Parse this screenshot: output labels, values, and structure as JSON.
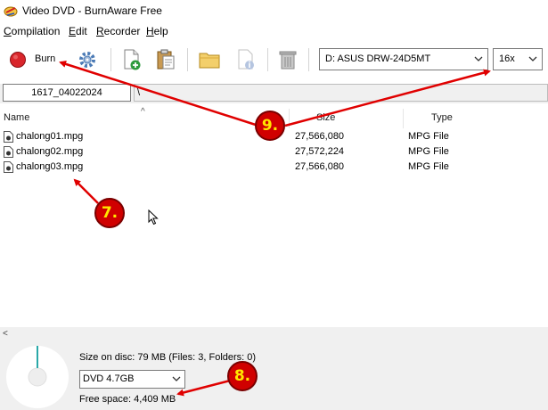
{
  "window": {
    "title": "Video DVD - BurnAware Free"
  },
  "menu": [
    {
      "label": "Compilation",
      "key": "C"
    },
    {
      "label": "Edit",
      "key": "E"
    },
    {
      "label": "Recorder",
      "key": "R"
    },
    {
      "label": "Help",
      "key": "H"
    }
  ],
  "toolbar": {
    "burn_label": "Burn",
    "drive": "D: ASUS DRW-24D5MT",
    "speed": "16x"
  },
  "pathbar": {
    "disc_label": "1617_04022024",
    "path": "\\"
  },
  "columns": {
    "name": "Name",
    "size": "Size",
    "type": "Type"
  },
  "files": [
    {
      "name": "chalong01.mpg",
      "size": "27,566,080",
      "type": "MPG File"
    },
    {
      "name": "chalong02.mpg",
      "size": "27,572,224",
      "type": "MPG File"
    },
    {
      "name": "chalong03.mpg",
      "size": "27,566,080",
      "type": "MPG File"
    }
  ],
  "status": {
    "size_on_disc": "Size on disc: 79 MB (Files: 3, Folders: 0)",
    "disc_type": "DVD 4.7GB",
    "free_space": "Free space: 4,409 MB"
  },
  "annotations": {
    "b7": "7.",
    "b8": "8.",
    "b9": "9."
  },
  "colors": {
    "annotation_red": "#e00000",
    "badge_text": "#ffe600"
  }
}
